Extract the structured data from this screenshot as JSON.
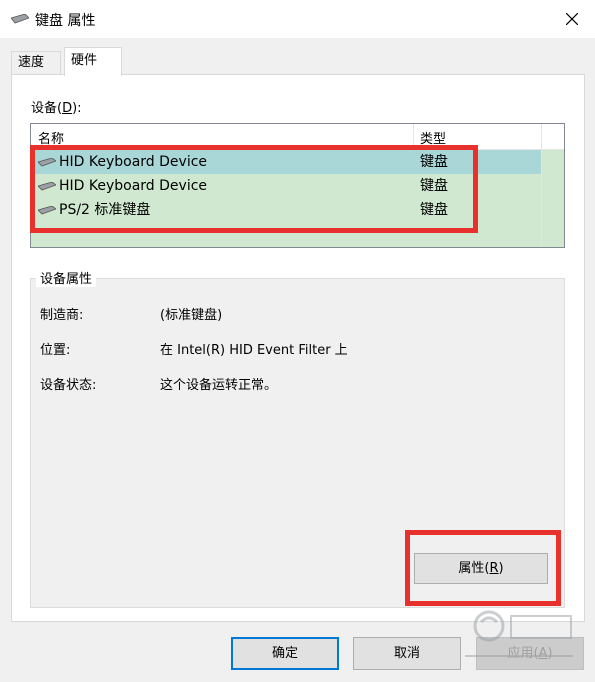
{
  "window": {
    "title": "键盘 属性",
    "icon": "keyboard-icon"
  },
  "tabs": [
    {
      "label": "速度",
      "active": false
    },
    {
      "label": "硬件",
      "active": true
    }
  ],
  "devices": {
    "label": "设备(",
    "label_key": "D",
    "label_end": "):",
    "columns": {
      "name": "名称",
      "type": "类型"
    },
    "rows": [
      {
        "name": "HID Keyboard Device",
        "type": "键盘",
        "selected": true
      },
      {
        "name": "HID Keyboard Device",
        "type": "键盘",
        "selected": false
      },
      {
        "name": "PS/2 标准键盘",
        "type": "键盘",
        "selected": false
      }
    ]
  },
  "properties": {
    "group_title": "设备属性",
    "manufacturer_label": "制造商:",
    "manufacturer_value": "(标准键盘)",
    "location_label": "位置:",
    "location_value": "在 Intel(R) HID Event Filter 上",
    "status_label": "设备状态:",
    "status_value": "这个设备运转正常。",
    "button_label": "属性(",
    "button_key": "R",
    "button_end": ")"
  },
  "buttons": {
    "ok": "确定",
    "cancel": "取消",
    "apply": "应用(",
    "apply_key": "A",
    "apply_end": ")"
  },
  "colors": {
    "highlight": "#e8302c",
    "selected_row": "#a9d6d6",
    "list_bg": "#cfe8cf",
    "default_button_border": "#0078d7"
  }
}
